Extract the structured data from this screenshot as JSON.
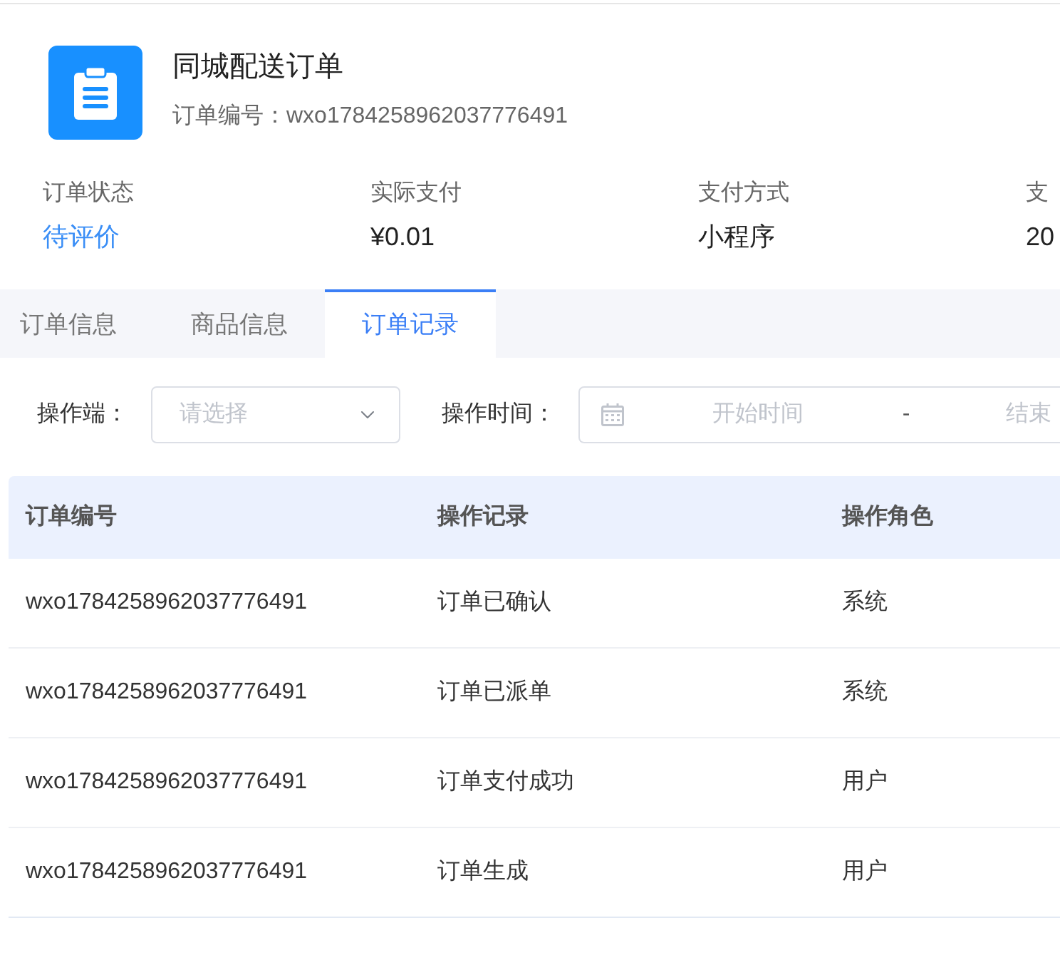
{
  "header": {
    "title": "同城配送订单",
    "order_number": "订单编号：wxo1784258962037776491"
  },
  "summary": [
    {
      "label": "订单状态",
      "value": "待评价",
      "kind": "status"
    },
    {
      "label": "实际支付",
      "value": "¥0.01",
      "kind": "text"
    },
    {
      "label": "支付方式",
      "value": "小程序",
      "kind": "text"
    },
    {
      "label": "支",
      "value": "20",
      "kind": "text"
    }
  ],
  "tabs": [
    {
      "label": "订单信息",
      "selected": false
    },
    {
      "label": "商品信息",
      "selected": false
    },
    {
      "label": "订单记录",
      "selected": true
    }
  ],
  "filters": {
    "operator": {
      "label": "操作端：",
      "placeholder": "请选择"
    },
    "time": {
      "label": "操作时间：",
      "start_placeholder": "开始时间",
      "separator": "-",
      "end_placeholder": "结束"
    }
  },
  "table": {
    "columns": [
      "订单编号",
      "操作记录",
      "操作角色"
    ],
    "rows": [
      [
        "wxo1784258962037776491",
        "订单已确认",
        "系统"
      ],
      [
        "wxo1784258962037776491",
        "订单已派单",
        "系统"
      ],
      [
        "wxo1784258962037776491",
        "订单支付成功",
        "用户"
      ],
      [
        "wxo1784258962037776491",
        "订单生成",
        "用户"
      ]
    ]
  }
}
